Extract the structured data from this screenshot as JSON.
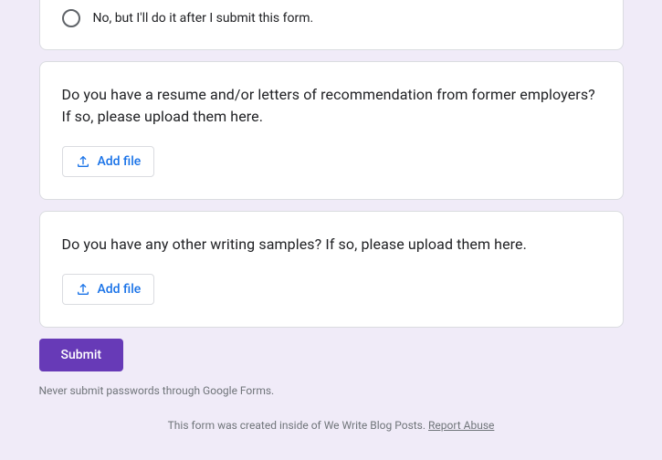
{
  "cards": {
    "radio_card": {
      "option_label": "No, but I'll do it after I submit this form."
    },
    "resume_card": {
      "question": "Do you have a resume and/or letters of recommendation from former employers? If so, please upload them here.",
      "add_file_label": "Add file"
    },
    "samples_card": {
      "question": "Do you have any other writing samples? If so, please upload them here.",
      "add_file_label": "Add file"
    }
  },
  "submit_label": "Submit",
  "footer": {
    "warning": "Never submit passwords through Google Forms.",
    "disclaimer_prefix": "This form was created inside of We Write Blog Posts. ",
    "report_abuse": "Report Abuse"
  },
  "colors": {
    "accent": "#673ab7",
    "link": "#1a73e8",
    "bg": "#f0ebf8"
  }
}
